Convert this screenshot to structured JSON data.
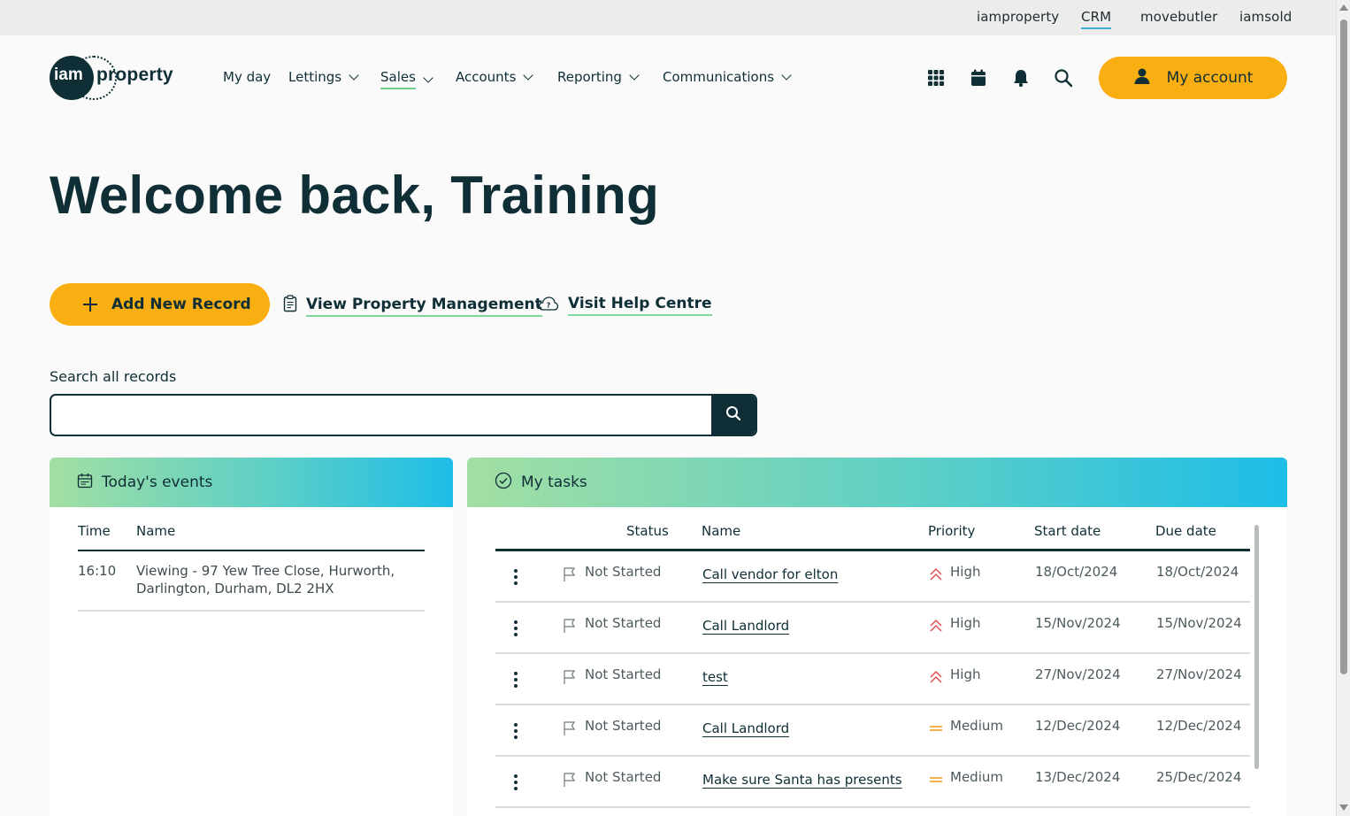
{
  "top_links": [
    "iamproperty",
    "CRM",
    "movebutler",
    "iamsold"
  ],
  "logo": {
    "iam": "iam",
    "property": "property"
  },
  "nav": {
    "items": [
      {
        "label": "My day",
        "dropdown": false
      },
      {
        "label": "Lettings",
        "dropdown": true
      },
      {
        "label": "Sales",
        "dropdown": true
      },
      {
        "label": "Accounts",
        "dropdown": true
      },
      {
        "label": "Reporting",
        "dropdown": true
      },
      {
        "label": "Communications",
        "dropdown": true
      }
    ]
  },
  "header_icons": [
    "apps-grid-icon",
    "calendar-icon",
    "bell-icon",
    "search-icon"
  ],
  "account_button": "My account",
  "welcome": "Welcome back, Training",
  "actions": {
    "add_record": "Add New Record",
    "view_pm": "View Property Management",
    "help_centre": "Visit Help Centre"
  },
  "search": {
    "label": "Search all records",
    "placeholder": ""
  },
  "events": {
    "title": "Today's events",
    "columns": [
      "Time",
      "Name"
    ],
    "rows": [
      {
        "time": "16:10",
        "name": "Viewing - 97 Yew Tree Close, Hurworth, Darlington, Durham, DL2 2HX"
      }
    ]
  },
  "tasks": {
    "title": "My tasks",
    "columns": [
      "Status",
      "Name",
      "Priority",
      "Start date",
      "Due date"
    ],
    "rows": [
      {
        "status": "Not Started",
        "name": "Call vendor for elton",
        "priority": "High",
        "start": "18/Oct/2024",
        "due": "18/Oct/2024"
      },
      {
        "status": "Not Started",
        "name": "Call Landlord",
        "priority": "High",
        "start": "15/Nov/2024",
        "due": "15/Nov/2024"
      },
      {
        "status": "Not Started",
        "name": "test",
        "priority": "High",
        "start": "27/Nov/2024",
        "due": "27/Nov/2024"
      },
      {
        "status": "Not Started",
        "name": "Call Landlord",
        "priority": "Medium",
        "start": "12/Dec/2024",
        "due": "12/Dec/2024"
      },
      {
        "status": "Not Started",
        "name": "Make sure Santa has presents",
        "priority": "Medium",
        "start": "13/Dec/2024",
        "due": "25/Dec/2024"
      }
    ]
  },
  "colors": {
    "brand_dark": "#0f2e36",
    "accent_yellow": "#f9ae11",
    "accent_green": "#6ccf8a",
    "high_priority": "#e0514f",
    "medium_priority": "#f2a93b"
  }
}
